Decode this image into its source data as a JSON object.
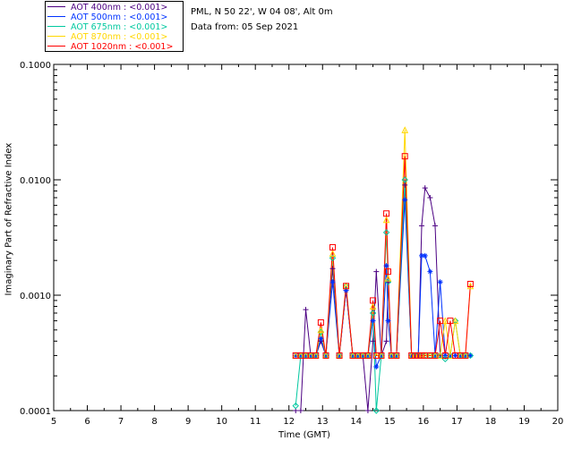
{
  "legend": [
    {
      "label": "AOT  400nm : <0.001>",
      "color": "#4b0082"
    },
    {
      "label": "AOT  500nm : <0.001>",
      "color": "#0033ff"
    },
    {
      "label": "AOT  675nm : <0.001>",
      "color": "#00c8a0"
    },
    {
      "label": "AOT  870nm : <0.001>",
      "color": "#ffd700"
    },
    {
      "label": "AOT 1020nm : <0.001>",
      "color": "#ff0000"
    }
  ],
  "info": {
    "site": "PML, N 50 22', W 04 08', Alt 0m",
    "date": "Data from: 05 Sep 2021"
  },
  "chart_data": {
    "type": "line",
    "title": "",
    "xlabel": "Time (GMT)",
    "ylabel": "Imaginary Part of Refractive Index",
    "xlim": [
      5,
      20
    ],
    "ylim": [
      0.0001,
      0.1
    ],
    "yscale": "log",
    "x_ticks": [
      "5",
      "6",
      "7",
      "8",
      "9",
      "10",
      "11",
      "12",
      "13",
      "14",
      "15",
      "16",
      "17",
      "18",
      "19",
      "20"
    ],
    "y_ticks": [
      "0.0001",
      "0.0010",
      "0.0100",
      "0.1000"
    ],
    "series": [
      {
        "name": "AOT  400nm : <0.001>",
        "color": "#4b0082",
        "marker": "+",
        "x": [
          12.2,
          12.35,
          12.5,
          12.65,
          12.8,
          12.95,
          13.1,
          13.3,
          13.5,
          13.7,
          13.9,
          14.05,
          14.2,
          14.35,
          14.5,
          14.6,
          14.75,
          14.9,
          14.95,
          15.05,
          15.2,
          15.45,
          15.65,
          15.75,
          15.85,
          15.95,
          16.05,
          16.2,
          16.35,
          16.5,
          16.65,
          16.8,
          16.95,
          17.1,
          17.25,
          17.4
        ],
        "y": [
          0.0001,
          0.0001,
          0.00075,
          0.0003,
          0.0003,
          0.0004,
          0.0003,
          0.0017,
          0.0003,
          0.0011,
          0.0003,
          0.0003,
          0.0003,
          0.0001,
          0.0004,
          0.0016,
          0.0003,
          0.0004,
          0.0013,
          0.0003,
          0.0003,
          0.009,
          0.0003,
          0.0003,
          0.0003,
          0.004,
          0.0085,
          0.007,
          0.004,
          0.0003,
          0.0003,
          0.0003,
          0.0003,
          0.0003,
          0.0003,
          0.0003
        ]
      },
      {
        "name": "AOT  500nm : <0.001>",
        "color": "#0033ff",
        "marker": "*",
        "x": [
          12.2,
          12.35,
          12.5,
          12.65,
          12.8,
          12.95,
          13.1,
          13.3,
          13.5,
          13.7,
          13.9,
          14.05,
          14.2,
          14.35,
          14.5,
          14.6,
          14.75,
          14.9,
          14.95,
          15.05,
          15.2,
          15.45,
          15.65,
          15.75,
          15.85,
          15.95,
          16.05,
          16.2,
          16.35,
          16.5,
          16.65,
          16.8,
          16.95,
          17.1,
          17.25,
          17.4
        ],
        "y": [
          0.0003,
          0.0003,
          0.0003,
          0.0003,
          0.0003,
          0.00042,
          0.0003,
          0.0013,
          0.0003,
          0.0011,
          0.0003,
          0.0003,
          0.0003,
          0.0003,
          0.0006,
          0.00024,
          0.0003,
          0.0018,
          0.0006,
          0.0003,
          0.0003,
          0.0067,
          0.0003,
          0.0003,
          0.0003,
          0.0022,
          0.0022,
          0.0016,
          0.0003,
          0.0013,
          0.0003,
          0.0003,
          0.0003,
          0.0003,
          0.0003,
          0.0003
        ]
      },
      {
        "name": "AOT  675nm : <0.001>",
        "color": "#00c8a0",
        "marker": "diamond",
        "x": [
          12.2,
          12.35,
          12.5,
          12.65,
          12.8,
          12.95,
          13.1,
          13.3,
          13.5,
          13.7,
          13.9,
          14.05,
          14.2,
          14.35,
          14.5,
          14.6,
          14.75,
          14.9,
          14.95,
          15.05,
          15.2,
          15.45,
          15.65,
          15.75,
          15.85,
          15.95,
          16.05,
          16.2,
          16.35,
          16.5,
          16.65,
          16.8,
          16.95,
          17.1,
          17.25,
          17.4
        ],
        "y": [
          0.00011,
          0.0003,
          0.0003,
          0.0003,
          0.0003,
          0.00048,
          0.0003,
          0.0021,
          0.0003,
          0.0012,
          0.0003,
          0.0003,
          0.0003,
          0.0003,
          0.0007,
          0.0001,
          0.0003,
          0.0035,
          0.0013,
          0.0003,
          0.0003,
          0.01,
          0.0003,
          0.0003,
          0.0003,
          0.0003,
          0.0003,
          0.0003,
          0.0003,
          0.0003,
          0.00028,
          0.0003,
          0.0006,
          0.0003,
          0.0003,
          0.0003
        ]
      },
      {
        "name": "AOT  870nm : <0.001>",
        "color": "#ffd700",
        "marker": "triangle",
        "x": [
          12.2,
          12.35,
          12.5,
          12.65,
          12.8,
          12.95,
          13.1,
          13.3,
          13.5,
          13.7,
          13.9,
          14.05,
          14.2,
          14.35,
          14.5,
          14.6,
          14.75,
          14.9,
          14.95,
          15.05,
          15.2,
          15.45,
          15.65,
          15.75,
          15.85,
          15.95,
          16.05,
          16.2,
          16.35,
          16.5,
          16.65,
          16.8,
          16.95,
          17.1,
          17.25,
          17.4
        ],
        "y": [
          0.0003,
          0.0003,
          0.0003,
          0.0003,
          0.0003,
          0.0005,
          0.0003,
          0.0023,
          0.0003,
          0.0012,
          0.0003,
          0.0003,
          0.0003,
          0.0003,
          0.0008,
          0.0003,
          0.0003,
          0.0045,
          0.0014,
          0.0003,
          0.0003,
          0.027,
          0.0003,
          0.0003,
          0.0003,
          0.0003,
          0.0003,
          0.0003,
          0.0003,
          0.0003,
          0.0006,
          0.0003,
          0.0006,
          0.0003,
          0.0003,
          0.0012
        ]
      },
      {
        "name": "AOT 1020nm : <0.001>",
        "color": "#ff0000",
        "marker": "square",
        "x": [
          12.2,
          12.35,
          12.5,
          12.65,
          12.8,
          12.95,
          13.1,
          13.3,
          13.5,
          13.7,
          13.9,
          14.05,
          14.2,
          14.35,
          14.5,
          14.6,
          14.75,
          14.9,
          14.95,
          15.05,
          15.2,
          15.45,
          15.65,
          15.75,
          15.85,
          15.95,
          16.05,
          16.2,
          16.35,
          16.5,
          16.65,
          16.8,
          16.95,
          17.1,
          17.25,
          17.4
        ],
        "y": [
          0.0003,
          0.0003,
          0.0003,
          0.0003,
          0.0003,
          0.00058,
          0.0003,
          0.0026,
          0.0003,
          0.0012,
          0.0003,
          0.0003,
          0.0003,
          0.0003,
          0.0009,
          0.0003,
          0.0003,
          0.0051,
          0.0016,
          0.0003,
          0.0003,
          0.016,
          0.0003,
          0.0003,
          0.0003,
          0.0003,
          0.0003,
          0.0003,
          0.0003,
          0.0006,
          0.0003,
          0.0006,
          0.0003,
          0.0003,
          0.0003,
          0.00125
        ]
      }
    ]
  }
}
